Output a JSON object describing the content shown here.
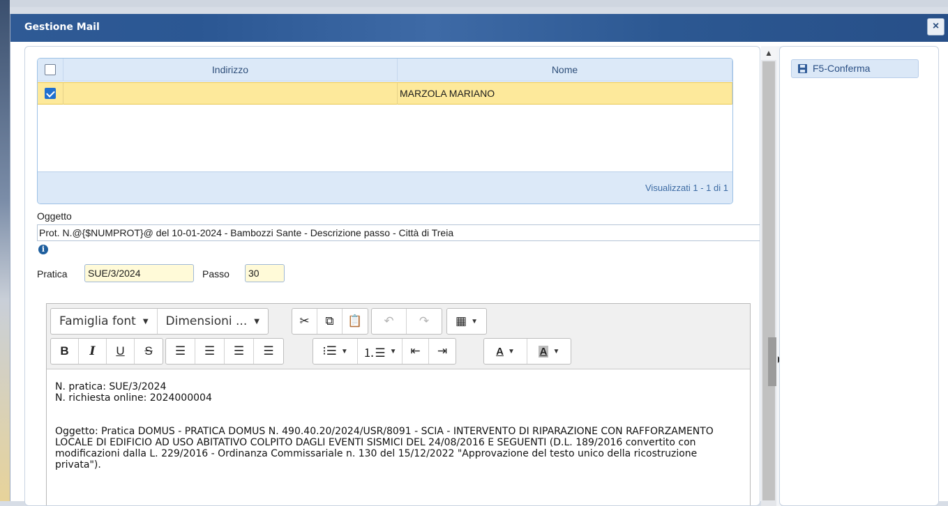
{
  "dialog": {
    "title": "Gestione Mail",
    "close_label": "×"
  },
  "grid": {
    "columns": [
      "Indirizzo",
      "Nome"
    ],
    "header_checked": false,
    "rows": [
      {
        "checked": true,
        "indirizzo": "",
        "nome": "MARZOLA MARIANO"
      }
    ],
    "pager": "Visualizzati 1 - 1 di 1"
  },
  "form": {
    "oggetto_label": "Oggetto",
    "oggetto_value": "Prot. N.@{$NUMPROT}@ del 10-01-2024 - Bambozzi Sante - Descrizione passo - Città di Treia",
    "pratica_label": "Pratica",
    "pratica_value": "SUE/3/2024",
    "passo_label": "Passo",
    "passo_value": "30"
  },
  "editor": {
    "font_family_label": "Famiglia font",
    "font_size_label": "Dimensioni ...",
    "body_line1": "N. pratica: SUE/3/2024",
    "body_line2": "N. richiesta online: 2024000004",
    "body_paragraph": "Oggetto: Pratica DOMUS - PRATICA DOMUS N. 490.40.20/2024/USR/8091 - SCIA - INTERVENTO DI RIPARAZIONE CON RAFFORZAMENTO LOCALE DI EDIFICIO AD USO ABITATIVO COLPITO DAGLI EVENTI SISMICI DEL 24/08/2016 E SEGUENTI (D.L. 189/2016 convertito con modificazioni dalla L. 229/2016 - Ordinanza Commissariale n. 130 del 15/12/2022 \"Approvazione del testo unico della ricostruzione privata\")."
  },
  "side": {
    "confirm_label": "F5-Conferma"
  },
  "colors": {
    "titlebar": "#2f5a95",
    "selected_row": "#fde99b",
    "grid_header": "#dce9f8",
    "accent": "#1f6fd1"
  }
}
